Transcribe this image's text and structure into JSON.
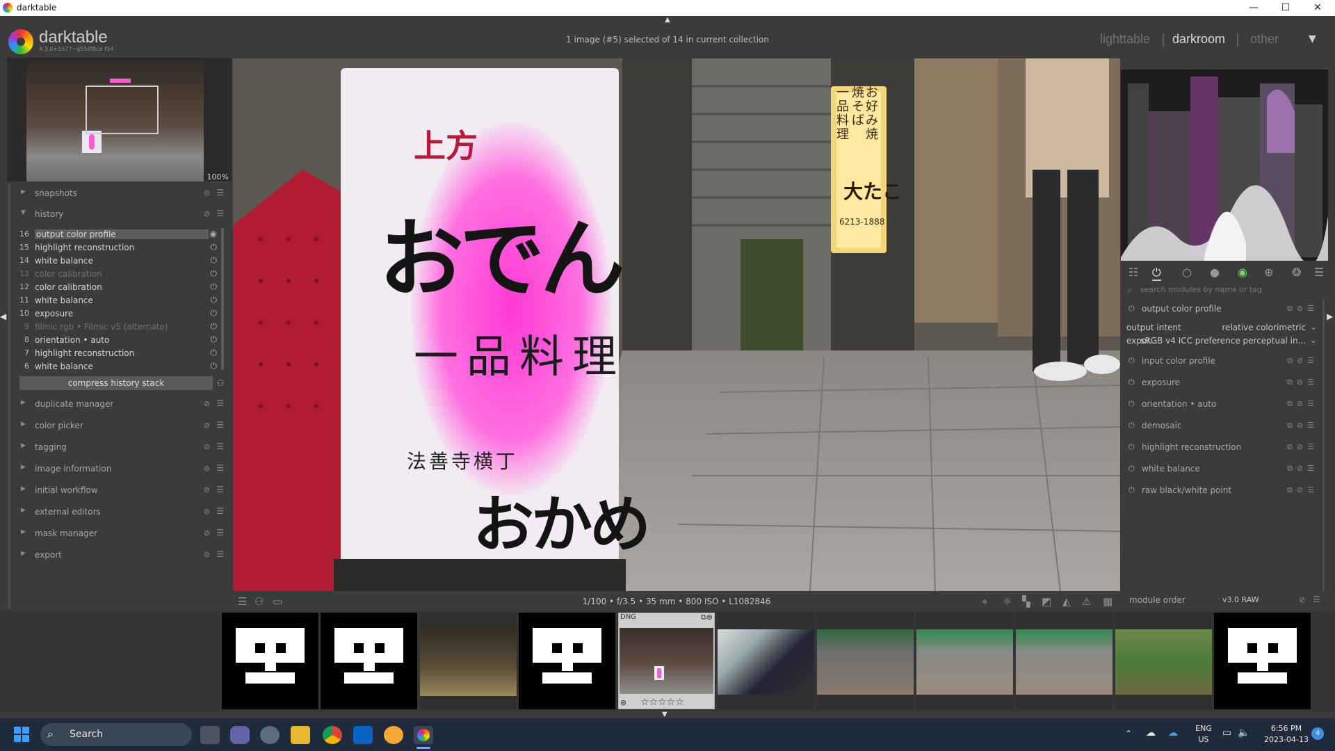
{
  "window": {
    "title": "darktable",
    "min": "—",
    "max": "☐",
    "close": "✕"
  },
  "header": {
    "app_name": "darktable",
    "version": "4.3.0+1577~g558f8ce f94",
    "selection_info": "1 image (#5) selected of 14 in current collection",
    "views": [
      "lighttable",
      "darkroom",
      "other"
    ],
    "active_view": "darkroom",
    "dropdown_icon": "triangle-down"
  },
  "navigation": {
    "zoom": "100%"
  },
  "left_modules": {
    "snapshots": "snapshots",
    "history": "history",
    "history_items": [
      {
        "num": "16",
        "label": "output color profile",
        "selected": true,
        "enabled": true
      },
      {
        "num": "15",
        "label": "highlight reconstruction",
        "enabled": true
      },
      {
        "num": "14",
        "label": "white balance",
        "enabled": true
      },
      {
        "num": "13",
        "label": "color calibration",
        "enabled": false
      },
      {
        "num": "12",
        "label": "color calibration",
        "enabled": true
      },
      {
        "num": "11",
        "label": "white balance",
        "enabled": true
      },
      {
        "num": "10",
        "label": "exposure",
        "enabled": true
      },
      {
        "num": "9",
        "label": "filmic rgb • Filmic v5 (alternate)",
        "enabled": false
      },
      {
        "num": "8",
        "label": "orientation • auto",
        "enabled": true
      },
      {
        "num": "7",
        "label": "highlight reconstruction",
        "enabled": true
      },
      {
        "num": "6",
        "label": "white balance",
        "enabled": true
      }
    ],
    "compress_button": "compress history stack",
    "others": [
      "duplicate manager",
      "color picker",
      "tagging",
      "image information",
      "initial workflow",
      "external editors",
      "mask manager",
      "export"
    ]
  },
  "image_info_line": "1/100 • f/3.5 • 35 mm • 800 ISO • L1082846",
  "right_panel": {
    "search_placeholder": "search modules by name or tag",
    "modules": [
      {
        "label": "output color profile",
        "expanded": true
      },
      {
        "label": "input color profile"
      },
      {
        "label": "exposure"
      },
      {
        "label": "orientation • auto"
      },
      {
        "label": "demosaic"
      },
      {
        "label": "highlight reconstruction"
      },
      {
        "label": "white balance"
      },
      {
        "label": "raw black/white point"
      }
    ],
    "output_intent_label": "output intent",
    "output_intent_value": "relative colorimetric",
    "export_label": "expor...",
    "export_value": "sRGB v4 ICC preference perceptual in...",
    "module_order_label": "module order",
    "module_order_value": "v3.0 RAW"
  },
  "filmstrip": {
    "selected_thumb_badge": "DNG",
    "stars": "☆☆☆☆☆",
    "reject_icon": "⊗"
  },
  "taskbar": {
    "search": "Search",
    "lang": "ENG",
    "region": "US",
    "time": "6:56 PM",
    "date": "2023-04-13",
    "notifications": "4"
  },
  "photo_text": {
    "top_label": "上方",
    "main": "おでん",
    "dish": "一品料理",
    "street": "法善寺横丁",
    "shop": "おかめ",
    "bg_sign": "大たこ",
    "bg_phone": "6213-1888",
    "bg_left": "一品料理",
    "bg_mid": "焼そば",
    "bg_right": "お好み焼"
  },
  "colors": {
    "accent": "#c9b27a",
    "sign_pink": "#ff4fd8",
    "sign_red": "#b8183a"
  }
}
